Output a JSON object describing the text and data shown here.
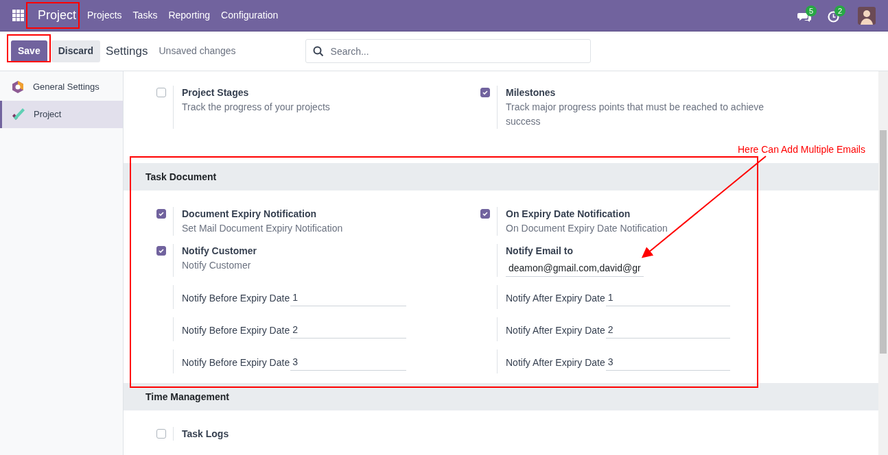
{
  "navbar": {
    "brand": "Project",
    "menu": [
      "Projects",
      "Tasks",
      "Reporting",
      "Configuration"
    ],
    "messages_badge": "5",
    "activities_badge": "2"
  },
  "control_bar": {
    "buttons": [
      {
        "label": "Save",
        "kind": "primary"
      },
      {
        "label": "Discard",
        "kind": "secondary"
      }
    ],
    "title": "Settings",
    "status": "Unsaved changes",
    "search": {
      "placeholder": "Search..."
    }
  },
  "sidebar": {
    "items": [
      {
        "label": "General Settings",
        "kind": "general",
        "selected": false
      },
      {
        "label": "Project",
        "kind": "project",
        "selected": true
      }
    ]
  },
  "sections": [
    {
      "settings": [
        {
          "kind": "checkbox",
          "title": "Project Stages",
          "description": "Track the progress of your projects",
          "checked": false
        },
        {
          "kind": "checkbox",
          "title": "Milestones",
          "description": "Track major progress points that must be reached to achieve success",
          "checked": true
        }
      ]
    },
    {
      "title": "Task Document",
      "settings": [
        {
          "kind": "checkbox",
          "title": "Document Expiry Notification",
          "description": "Set Mail Document Expiry Notification",
          "checked": true
        },
        {
          "kind": "checkbox",
          "title": "On Expiry Date Notification",
          "description": "On Document Expiry Date Notification",
          "checked": true
        },
        {
          "kind": "checkbox",
          "title": "Notify Customer",
          "description": "Notify Customer",
          "checked": true
        },
        {
          "kind": "email",
          "title": "Notify Email to",
          "value": "deamon@gmail.com,david@gr"
        },
        {
          "kind": "field",
          "title": "Notify Before Expiry Date",
          "value": "1"
        },
        {
          "kind": "field",
          "title": "Notify After Expiry Date",
          "value": "1"
        },
        {
          "kind": "field",
          "title": "Notify Before Expiry Date",
          "value": "2"
        },
        {
          "kind": "field",
          "title": "Notify After Expiry Date",
          "value": "2"
        },
        {
          "kind": "field",
          "title": "Notify Before Expiry Date",
          "value": "3"
        },
        {
          "kind": "field",
          "title": "Notify After Expiry Date",
          "value": "3"
        }
      ]
    },
    {
      "title": "Time Management",
      "settings": [
        {
          "kind": "checkbox",
          "title": "Task Logs",
          "checked": false
        }
      ]
    }
  ],
  "annotation": {
    "text": "Here Can Add Multiple Emails"
  }
}
